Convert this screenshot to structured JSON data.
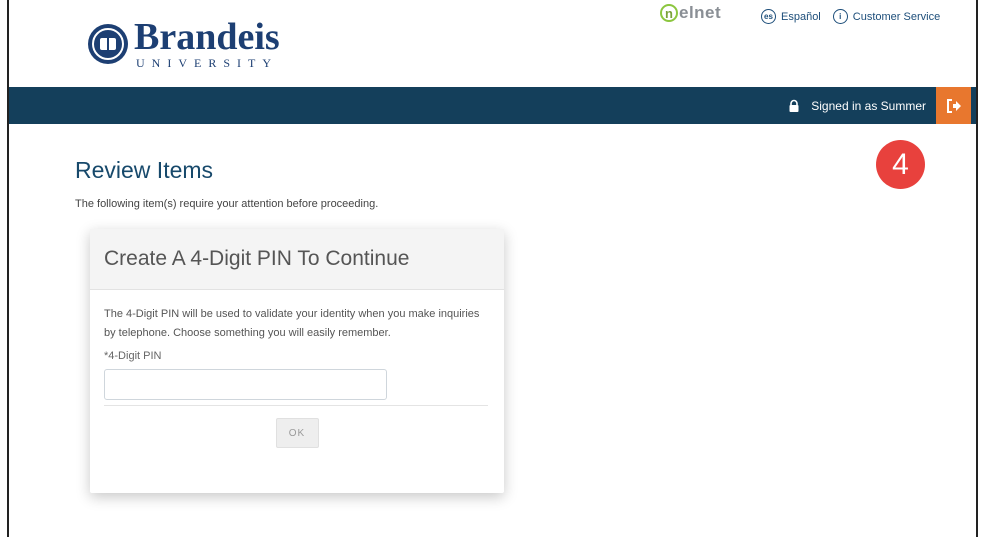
{
  "header": {
    "logo_name": "Brandeis",
    "logo_sub": "UNIVERSITY",
    "nelnet_word": "elnet",
    "nelnet_letter": "n",
    "links": {
      "espanol_icon_text": "es",
      "espanol": "Español",
      "info_icon_text": "i",
      "customer_service": "Customer Service"
    }
  },
  "navbar": {
    "signed_in_text": "Signed in as Summer"
  },
  "badge": "4",
  "main": {
    "title": "Review Items",
    "subtitle": "The following item(s) require your attention before proceeding."
  },
  "card": {
    "title": "Create A 4-Digit PIN To Continue",
    "description": "The 4-Digit PIN will be used to validate your identity when you make inquiries by telephone. Choose something you will easily remember.",
    "pin_label": "*4-Digit PIN",
    "pin_value": "",
    "ok_label": "OK"
  },
  "colors": {
    "navbar": "#143f5b",
    "logout": "#e8772e",
    "badge": "#e8413d",
    "brand": "#1d3f73"
  }
}
